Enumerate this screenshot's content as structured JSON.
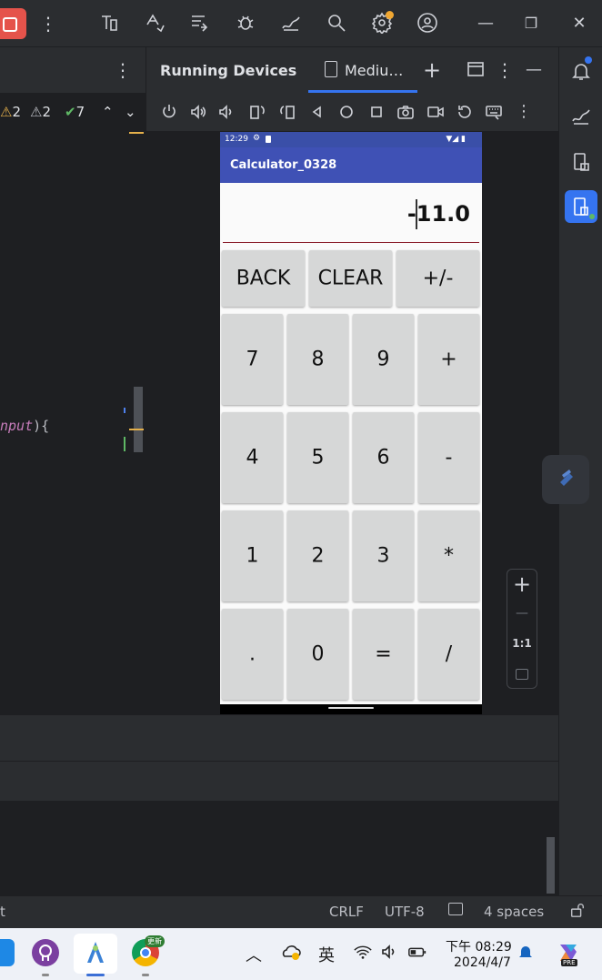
{
  "ide": {
    "editor": {
      "warning_count_1": "2",
      "warning_count_2": "2",
      "check_count": "7",
      "code_fragment": "nput",
      "code_brace": "){"
    },
    "running_devices": {
      "title": "Running Devices",
      "tab_label": "Mediu…"
    },
    "status_bar": {
      "left_fragment": "t",
      "line_separator": "CRLF",
      "encoding": "UTF-8",
      "indent": "4 spaces"
    },
    "zoom": {
      "plus": "+",
      "minus": "—",
      "one_to_one": "1:1"
    }
  },
  "phone": {
    "status_time": "12:29",
    "status_icons": "▼◢ ▮",
    "app_title": "Calculator_0328",
    "display_value": "-11.0",
    "keys_top": [
      "BACK",
      "CLEAR",
      "+/-"
    ],
    "keys_grid": [
      [
        "7",
        "8",
        "9",
        "+"
      ],
      [
        "4",
        "5",
        "6",
        "-"
      ],
      [
        "1",
        "2",
        "3",
        "*"
      ],
      [
        ".",
        "0",
        "=",
        "/"
      ]
    ]
  },
  "taskbar": {
    "chrome_badge": "更新",
    "ime_label": "英",
    "clock_time": "下午 08:29",
    "clock_date": "2024/4/7",
    "copilot_badge": "PRE"
  },
  "colors": {
    "ide_bg": "#2b2d30",
    "editor_bg": "#1e1f22",
    "accent_blue": "#3574f0",
    "phone_appbar": "#3f51b5",
    "phone_statusbar": "#3a4fa8",
    "key_bg": "#d6d7d7",
    "display_underline": "#8b1f2c"
  }
}
